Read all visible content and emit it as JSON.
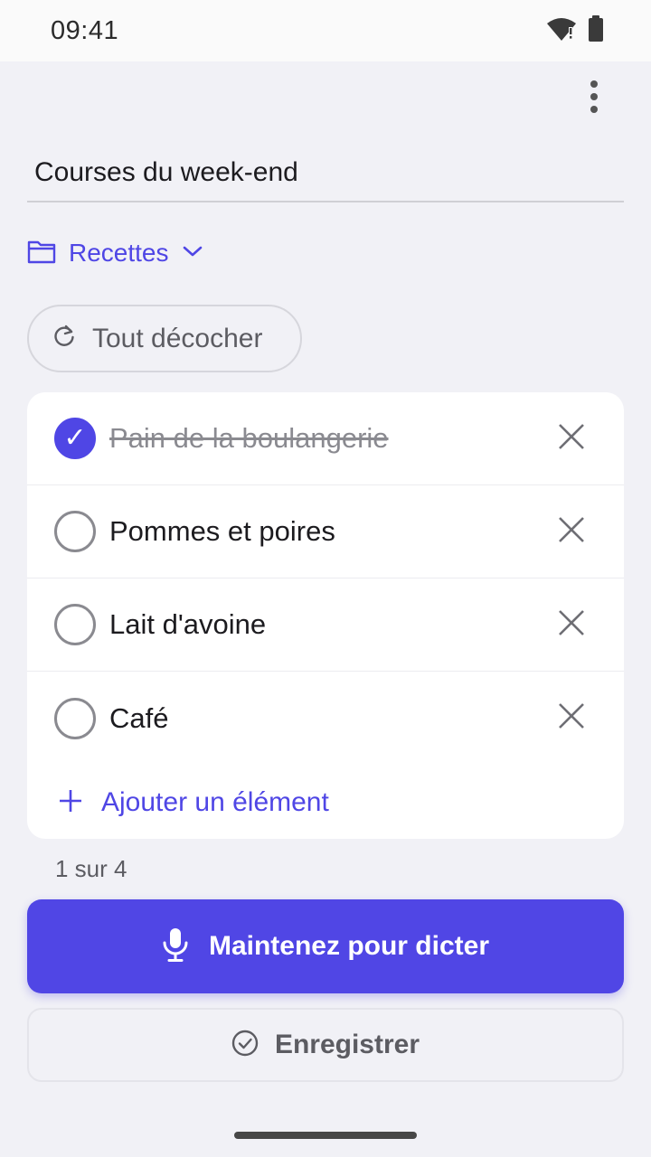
{
  "status_bar": {
    "time": "09:41",
    "wifi_icon": "wifi-alert-icon",
    "battery_icon": "battery-full-icon"
  },
  "header": {
    "menu_icon": "more-vert-icon"
  },
  "list": {
    "title": "Courses du week-end",
    "folder": {
      "label": "Recettes",
      "icon": "folder-icon"
    },
    "reset_label": "Tout décocher",
    "items": [
      {
        "label": "Pain de la boulangerie",
        "checked": true
      },
      {
        "label": "Pommes et poires",
        "checked": false
      },
      {
        "label": "Lait d'avoine",
        "checked": false
      },
      {
        "label": "Café",
        "checked": false
      }
    ],
    "add_label": "Ajouter un élément",
    "counter": "1 sur 4"
  },
  "actions": {
    "dictate_label": "Maintenez pour dicter",
    "save_label": "Enregistrer"
  },
  "colors": {
    "accent": "#4f46e5",
    "background": "#f1f1f6",
    "card": "#ffffff"
  }
}
